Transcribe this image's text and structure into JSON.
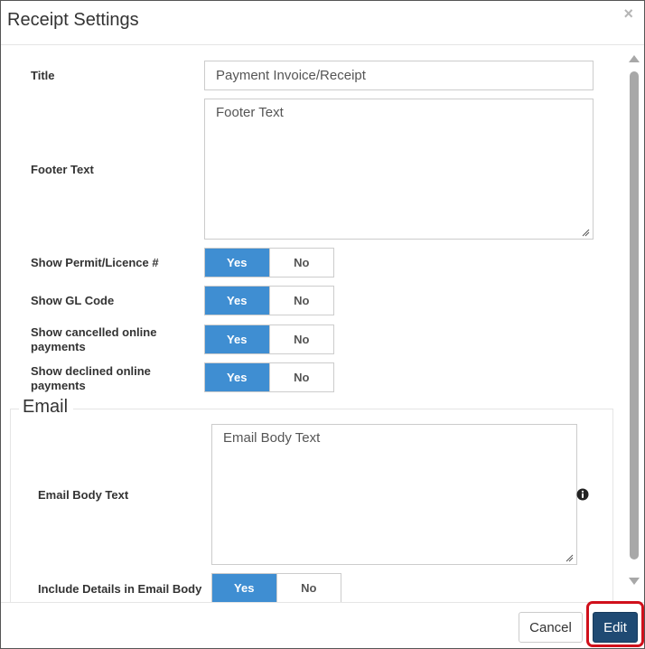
{
  "dialog": {
    "title": "Receipt Settings",
    "close_symbol": "×"
  },
  "form": {
    "title_label": "Title",
    "title_value": "Payment Invoice/Receipt",
    "footer_label": "Footer Text",
    "footer_value": "Footer Text",
    "rows": [
      {
        "label_line1": "Show Permit/Licence #",
        "label_line2": "",
        "yes": "Yes",
        "no": "No",
        "selected": "Yes"
      },
      {
        "label_line1": "Show GL Code",
        "label_line2": "",
        "yes": "Yes",
        "no": "No",
        "selected": "Yes"
      },
      {
        "label_line1": "Show cancelled online",
        "label_line2": "payments",
        "yes": "Yes",
        "no": "No",
        "selected": "Yes"
      },
      {
        "label_line1": "Show declined online",
        "label_line2": "payments",
        "yes": "Yes",
        "no": "No",
        "selected": "Yes"
      }
    ]
  },
  "email": {
    "legend": "Email",
    "body_label": "Email Body Text",
    "body_value": "Email Body Text",
    "info_icon": "info-icon",
    "include_label": "Include Details in Email Body",
    "include_yes": "Yes",
    "include_no": "No",
    "include_selected": "Yes"
  },
  "footer": {
    "cancel_label": "Cancel",
    "edit_label": "Edit"
  },
  "colors": {
    "toggle_selected": "#3f8ed2",
    "edit_button": "#1f4a73",
    "highlight": "#d0101b"
  }
}
